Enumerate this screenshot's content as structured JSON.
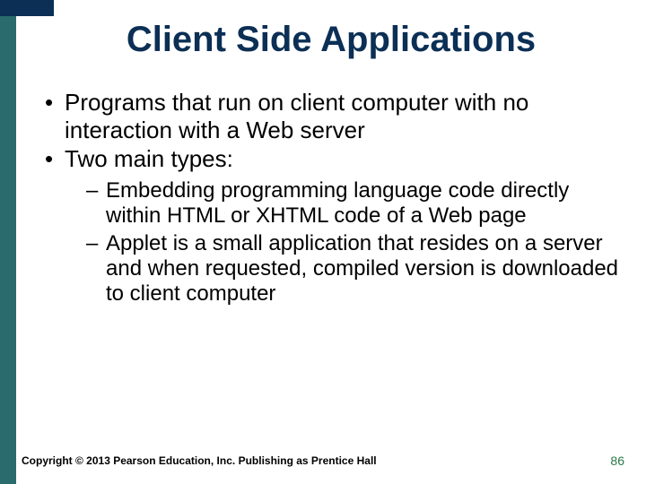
{
  "slide": {
    "title": "Client Side Applications",
    "bullets": {
      "level1": [
        "Programs that run on client computer with no interaction with a Web server",
        "Two main types:"
      ],
      "level2": [
        "Embedding programming language code directly within HTML or XHTML code of  a Web page",
        "Applet is a small application that resides on a server and when requested, compiled version is downloaded to client computer"
      ]
    }
  },
  "footer": {
    "copyright": "Copyright © 2013 Pearson Education, Inc. Publishing as Prentice Hall",
    "page_number": "86"
  }
}
